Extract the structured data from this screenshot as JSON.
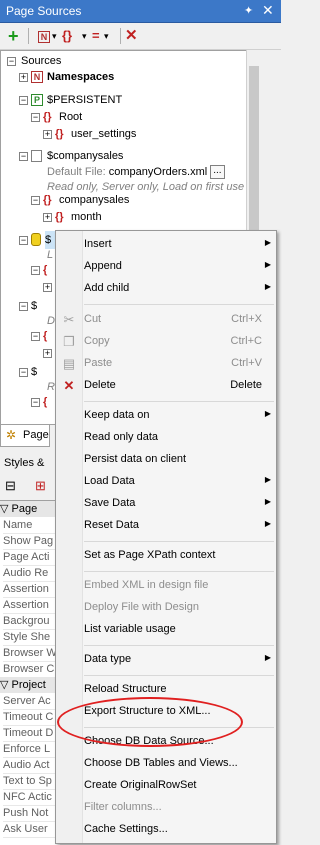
{
  "titlebar": {
    "title": "Page Sources",
    "pin": "✦",
    "close": "✕"
  },
  "toolbar": {
    "add": "+",
    "ns_icon": "N",
    "xml_icon": "{}",
    "eq": "=",
    "delete": "✕",
    "drop": "▾"
  },
  "tree": {
    "sources": "Sources",
    "namespaces": "Namespaces",
    "persistent": "$PERSISTENT",
    "root": "Root",
    "user_settings": "user_settings",
    "companysales": "$companysales",
    "default_file_label": "Default File:",
    "default_file_value": "companyOrders.xml",
    "file_button": "...",
    "file_info": "Read only, Server only, Load on first use",
    "companysales_child": "companysales",
    "month": "month",
    "partial_s1": "$",
    "partial_s2": "$",
    "partial_s3": "$",
    "partial_s4": "$",
    "partial_d": "D",
    "partial_r": "R",
    "partial_l": "L"
  },
  "bottom": {
    "page_tab": "Page",
    "styles_header": "Styles &",
    "props": [
      "Page",
      "Name",
      "Show Pag",
      "Page Acti",
      "Audio Re",
      "Assertion",
      "Assertion",
      "Backgrou",
      "Style She",
      "Browser W",
      "Browser C",
      "Project",
      "Server Ac",
      "Timeout C",
      "Timeout D",
      "Enforce L",
      "Audio Act",
      "Text to Sp",
      "NFC Actic",
      "Push Not",
      "Ask User"
    ]
  },
  "menu": {
    "insert": "Insert",
    "append": "Append",
    "add_child": "Add child",
    "cut": "Cut",
    "cut_sc": "Ctrl+X",
    "copy": "Copy",
    "copy_sc": "Ctrl+C",
    "paste": "Paste",
    "paste_sc": "Ctrl+V",
    "delete": "Delete",
    "delete_sc": "Delete",
    "keep_data_on": "Keep data on",
    "read_only_data": "Read only data",
    "persist_data": "Persist data on client",
    "load_data": "Load Data",
    "save_data": "Save Data",
    "reset_data": "Reset Data",
    "set_xpath": "Set as Page XPath context",
    "embed_xml": "Embed XML in design file",
    "deploy_file": "Deploy File with Design",
    "list_usage": "List variable usage",
    "data_type": "Data type",
    "reload": "Reload Structure",
    "export": "Export Structure to XML...",
    "choose_db_source": "Choose DB Data Source...",
    "choose_db_tables": "Choose DB Tables and Views...",
    "create_rowset": "Create OriginalRowSet",
    "filter_columns": "Filter columns...",
    "cache_settings": "Cache Settings..."
  },
  "colors": {
    "accent": "#3c78c8",
    "highlight_circle": "#e02020"
  }
}
